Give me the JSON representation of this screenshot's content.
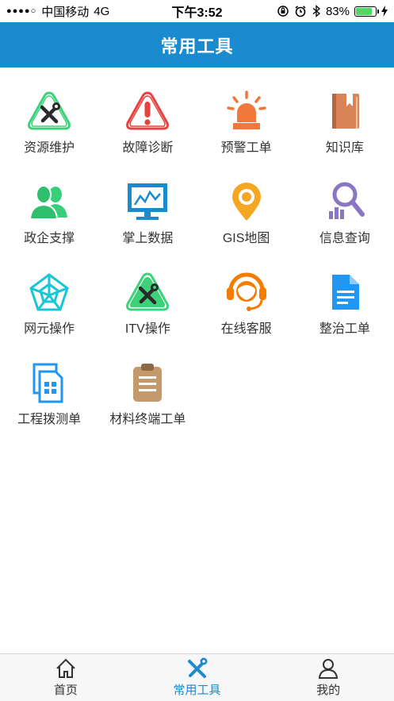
{
  "status_bar": {
    "signal": "●●●●○",
    "carrier": "中国移动",
    "network": "4G",
    "time": "下午3:52",
    "battery_percent": "83%",
    "battery_level": 0.83
  },
  "nav": {
    "title": "常用工具"
  },
  "tools": [
    {
      "label": "资源维护",
      "icon": "tools-triangle-icon"
    },
    {
      "label": "故障诊断",
      "icon": "warning-triangle-icon"
    },
    {
      "label": "预警工单",
      "icon": "alarm-light-icon"
    },
    {
      "label": "知识库",
      "icon": "book-icon"
    },
    {
      "label": "政企支撑",
      "icon": "users-icon"
    },
    {
      "label": "掌上数据",
      "icon": "monitor-chart-icon"
    },
    {
      "label": "GIS地图",
      "icon": "map-pin-icon"
    },
    {
      "label": "信息查询",
      "icon": "search-chart-icon"
    },
    {
      "label": "网元操作",
      "icon": "network-web-icon"
    },
    {
      "label": "ITV操作",
      "icon": "tools-triangle-green-icon"
    },
    {
      "label": "在线客服",
      "icon": "headset-agent-icon"
    },
    {
      "label": "整治工单",
      "icon": "document-icon"
    },
    {
      "label": "工程拨测单",
      "icon": "files-qr-icon"
    },
    {
      "label": "材料终端工单",
      "icon": "clipboard-icon"
    }
  ],
  "tabs": [
    {
      "label": "首页",
      "icon": "home-icon",
      "active": false
    },
    {
      "label": "常用工具",
      "icon": "tools-icon",
      "active": true
    },
    {
      "label": "我的",
      "icon": "user-icon",
      "active": false
    }
  ],
  "colors": {
    "nav_bg": "#1b8bd0",
    "active_tab": "#1b8bd0",
    "battery": "#4cd964"
  }
}
